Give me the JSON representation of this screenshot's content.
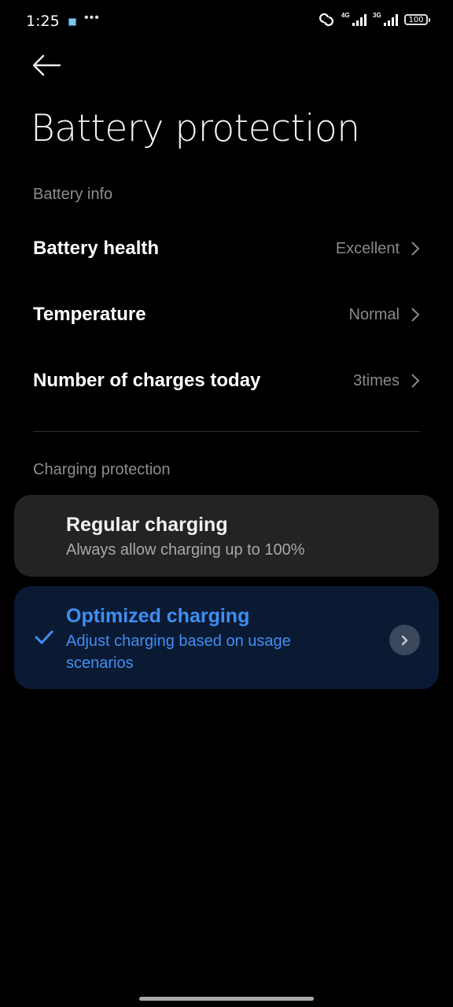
{
  "status_bar": {
    "time": "1:25",
    "more": "•••",
    "icons": [
      "notification-app-icon",
      "hotspot-link-icon",
      "signal-4g-icon",
      "signal-3g-icon",
      "battery-icon"
    ],
    "signal_1_label": "4G",
    "signal_2_label": "3G",
    "battery_level": "100"
  },
  "header": {
    "back_icon": "arrow-left-icon",
    "title": "Battery protection"
  },
  "battery_info": {
    "section_label": "Battery info",
    "rows": [
      {
        "label": "Battery health",
        "value": "Excellent"
      },
      {
        "label": "Temperature",
        "value": "Normal"
      },
      {
        "label": "Number of charges today",
        "value": "3times"
      }
    ]
  },
  "charging_protection": {
    "section_label": "Charging protection",
    "options": [
      {
        "title": "Regular charging",
        "subtitle": "Always allow charging up to 100%",
        "selected": false
      },
      {
        "title": "Optimized charging",
        "subtitle": "Adjust charging based on usage scenarios",
        "selected": true
      }
    ]
  },
  "colors": {
    "accent": "#3f8ef3",
    "selected_card_bg": "#0b1a33",
    "card_bg": "#232323"
  }
}
